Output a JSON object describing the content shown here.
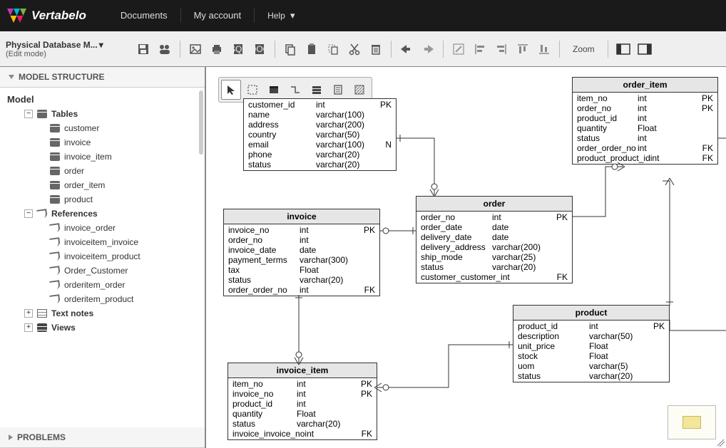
{
  "header": {
    "brand": "Vertabelo",
    "menu": [
      "Documents",
      "My account",
      "Help"
    ]
  },
  "subheader": {
    "title": "Physical Database M...",
    "subtitle": "(Edit mode)",
    "zoom_label": "Zoom"
  },
  "sidebar": {
    "structure_label": "MODEL STRUCTURE",
    "problems_label": "PROBLEMS",
    "root": "Model",
    "groups": {
      "tables": {
        "label": "Tables",
        "items": [
          "customer",
          "invoice",
          "invoice_item",
          "order",
          "order_item",
          "product"
        ]
      },
      "references": {
        "label": "References",
        "items": [
          "invoice_order",
          "invoiceitem_invoice",
          "invoiceitem_product",
          "Order_Customer",
          "orderitem_order",
          "orderitem_product"
        ]
      },
      "text_notes": {
        "label": "Text notes"
      },
      "views": {
        "label": "Views"
      }
    }
  },
  "entities": {
    "customer": {
      "title": "",
      "rows": [
        {
          "name": "customer_id",
          "type": "int",
          "flag": "PK"
        },
        {
          "name": "name",
          "type": "varchar(100)",
          "flag": ""
        },
        {
          "name": "address",
          "type": "varchar(200)",
          "flag": ""
        },
        {
          "name": "country",
          "type": "varchar(50)",
          "flag": ""
        },
        {
          "name": "email",
          "type": "varchar(100)",
          "flag": "N"
        },
        {
          "name": "phone",
          "type": "varchar(20)",
          "flag": ""
        },
        {
          "name": "status",
          "type": "varchar(20)",
          "flag": ""
        }
      ]
    },
    "order_item": {
      "title": "order_item",
      "rows": [
        {
          "name": "item_no",
          "type": "int",
          "flag": "PK"
        },
        {
          "name": "order_no",
          "type": "int",
          "flag": "PK"
        },
        {
          "name": "product_id",
          "type": "int",
          "flag": ""
        },
        {
          "name": "quantity",
          "type": "Float",
          "flag": ""
        },
        {
          "name": "status",
          "type": "int",
          "flag": ""
        },
        {
          "name": "order_order_no",
          "type": "int",
          "flag": "FK"
        },
        {
          "name": "product_product_id",
          "type": "int",
          "flag": "FK"
        }
      ]
    },
    "invoice": {
      "title": "invoice",
      "rows": [
        {
          "name": "invoice_no",
          "type": "int",
          "flag": "PK"
        },
        {
          "name": "order_no",
          "type": "int",
          "flag": ""
        },
        {
          "name": "invoice_date",
          "type": "date",
          "flag": ""
        },
        {
          "name": "payment_terms",
          "type": "varchar(300)",
          "flag": ""
        },
        {
          "name": "tax",
          "type": "Float",
          "flag": ""
        },
        {
          "name": "status",
          "type": "varchar(20)",
          "flag": ""
        },
        {
          "name": "order_order_no",
          "type": "int",
          "flag": "FK"
        }
      ]
    },
    "order": {
      "title": "order",
      "rows": [
        {
          "name": "order_no",
          "type": "int",
          "flag": "PK"
        },
        {
          "name": "order_date",
          "type": "date",
          "flag": ""
        },
        {
          "name": "delivery_date",
          "type": "date",
          "flag": ""
        },
        {
          "name": "delivery_address",
          "type": "varchar(200)",
          "flag": ""
        },
        {
          "name": "ship_mode",
          "type": "varchar(25)",
          "flag": ""
        },
        {
          "name": "status",
          "type": "varchar(20)",
          "flag": ""
        },
        {
          "name": "customer_customer_",
          "type": "int",
          "flag": "FK"
        }
      ]
    },
    "product": {
      "title": "product",
      "rows": [
        {
          "name": "product_id",
          "type": "int",
          "flag": "PK"
        },
        {
          "name": "description",
          "type": "varchar(50)",
          "flag": ""
        },
        {
          "name": "unit_price",
          "type": "Float",
          "flag": ""
        },
        {
          "name": "stock",
          "type": "Float",
          "flag": ""
        },
        {
          "name": "uom",
          "type": "varchar(5)",
          "flag": ""
        },
        {
          "name": "status",
          "type": "varchar(20)",
          "flag": ""
        }
      ]
    },
    "invoice_item": {
      "title": "invoice_item",
      "rows": [
        {
          "name": "item_no",
          "type": "int",
          "flag": "PK"
        },
        {
          "name": "invoice_no",
          "type": "int",
          "flag": "PK"
        },
        {
          "name": "product_id",
          "type": "int",
          "flag": ""
        },
        {
          "name": "quantity",
          "type": "Float",
          "flag": ""
        },
        {
          "name": "status",
          "type": "varchar(20)",
          "flag": ""
        },
        {
          "name": "invoice_invoice_no",
          "type": "int",
          "flag": "FK"
        }
      ]
    }
  }
}
